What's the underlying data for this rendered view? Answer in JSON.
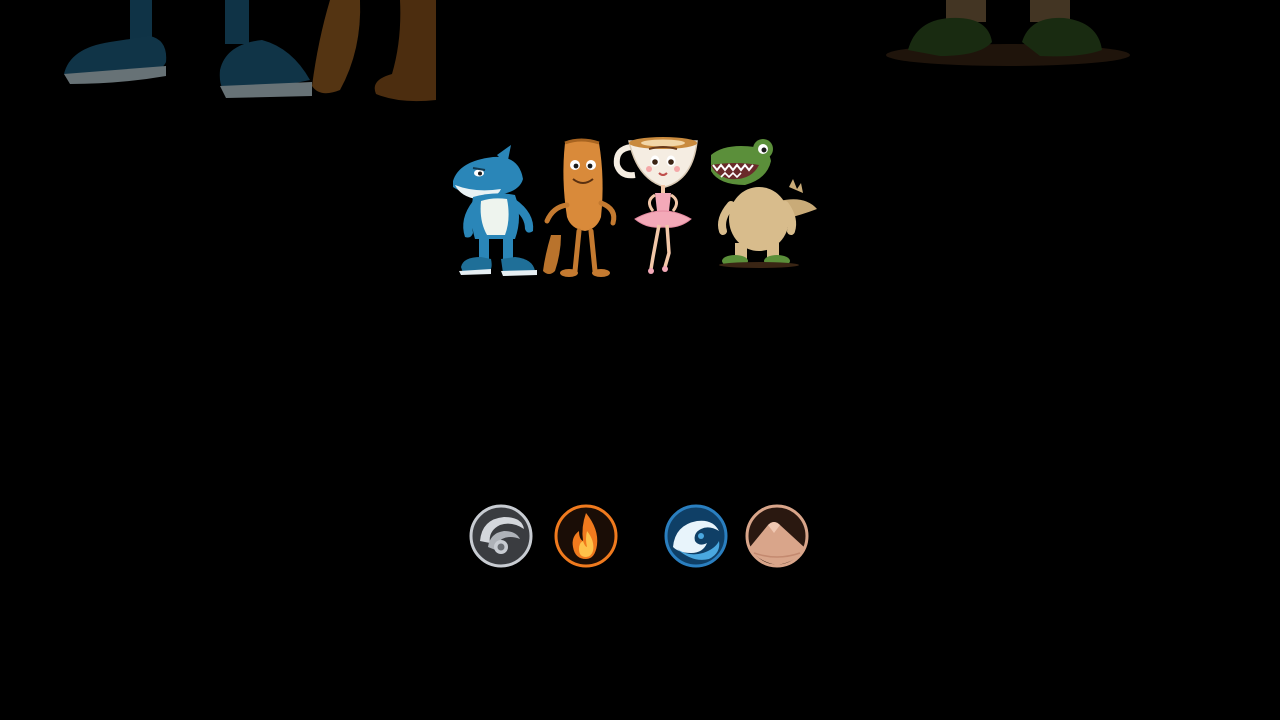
{
  "characters": [
    {
      "name": "shark",
      "icon": "shark-character-icon"
    },
    {
      "name": "paddle",
      "icon": "paddle-character-icon"
    },
    {
      "name": "ballerina-cup",
      "icon": "cappuccino-ballerina-icon"
    },
    {
      "name": "crocodile",
      "icon": "crocodile-character-icon"
    }
  ],
  "elements": [
    {
      "name": "air",
      "icon": "air-element-icon",
      "color": "#c8ccd2"
    },
    {
      "name": "fire",
      "icon": "fire-element-icon",
      "color": "#f07a1e"
    },
    {
      "name": "water",
      "icon": "water-element-icon",
      "color": "#2a7fc0"
    },
    {
      "name": "earth",
      "icon": "earth-element-icon",
      "color": "#d9a58a"
    }
  ],
  "colors": {
    "background": "#000000",
    "shark": "#2a86b8",
    "paddle": "#d98a3a",
    "tutu": "#f3a9b8",
    "crocodile_head": "#5b8f3a",
    "crocodile_body": "#d8bc8c"
  }
}
